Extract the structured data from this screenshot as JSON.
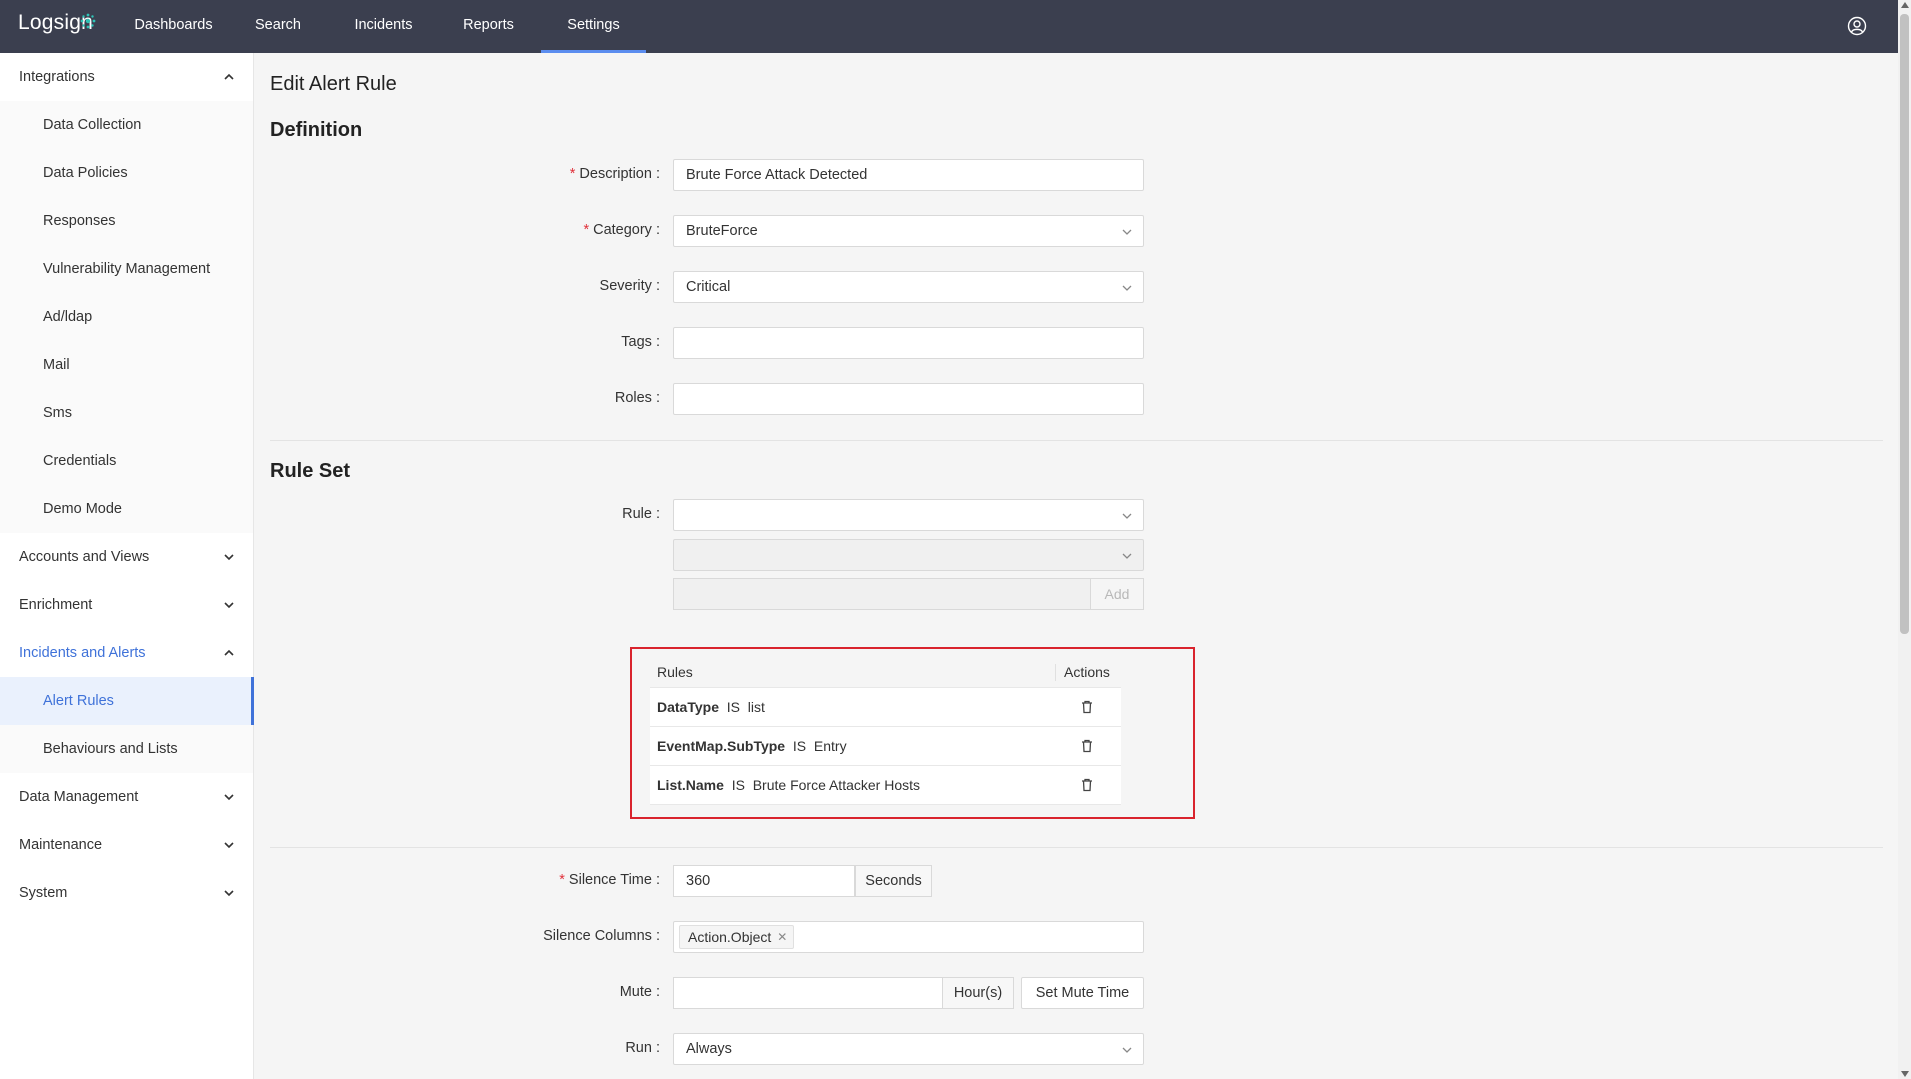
{
  "app": {
    "logo_text": "Logsign",
    "nav": [
      "Dashboards",
      "Search",
      "Incidents",
      "Reports",
      "Settings"
    ],
    "active_nav": "Settings",
    "user_icon": "user-circle-icon"
  },
  "sidebar": {
    "groups": [
      {
        "label": "Integrations",
        "expanded": true,
        "items": [
          "Data Collection",
          "Data Policies",
          "Responses",
          "Vulnerability Management",
          "Ad/ldap",
          "Mail",
          "Sms",
          "Credentials",
          "Demo Mode"
        ]
      },
      {
        "label": "Accounts and Views",
        "expanded": false
      },
      {
        "label": "Enrichment",
        "expanded": false
      },
      {
        "label": "Incidents and Alerts",
        "expanded": true,
        "items": [
          "Alert Rules",
          "Behaviours and Lists"
        ]
      },
      {
        "label": "Data Management",
        "expanded": false
      },
      {
        "label": "Maintenance",
        "expanded": false
      },
      {
        "label": "System",
        "expanded": false
      }
    ],
    "active_item": "Alert Rules"
  },
  "page": {
    "title": "Edit Alert Rule",
    "definition_heading": "Definition",
    "rule_set_heading": "Rule Set"
  },
  "form": {
    "description": {
      "label": "Description",
      "value": "Brute Force Attack Detected",
      "required": true
    },
    "category": {
      "label": "Category",
      "value": "BruteForce",
      "required": true
    },
    "severity": {
      "label": "Severity",
      "value": "Critical"
    },
    "tags": {
      "label": "Tags",
      "value": ""
    },
    "roles": {
      "label": "Roles",
      "value": ""
    },
    "rule": {
      "label": "Rule",
      "value": ""
    },
    "add_label": "Add",
    "silence_time": {
      "label": "Silence Time",
      "value": "360",
      "unit": "Seconds",
      "required": true
    },
    "silence_columns": {
      "label": "Silence Columns",
      "tags": [
        "Action.Object"
      ]
    },
    "mute": {
      "label": "Mute",
      "unit": "Hour(s)",
      "button": "Set Mute Time"
    },
    "run": {
      "label": "Run",
      "value": "Always"
    }
  },
  "rules_table": {
    "headers": [
      "Rules",
      "Actions"
    ],
    "rows": [
      {
        "field": "DataType",
        "op": "IS",
        "value": "list"
      },
      {
        "field": "EventMap.SubType",
        "op": "IS",
        "value": "Entry"
      },
      {
        "field": "List.Name",
        "op": "IS",
        "value": "Brute Force Attacker Hosts"
      }
    ]
  },
  "colors": {
    "topbar": "#3b3f4f",
    "accent": "#3f72d9",
    "highlight_box": "#d9232d",
    "required": "#e0303a"
  }
}
